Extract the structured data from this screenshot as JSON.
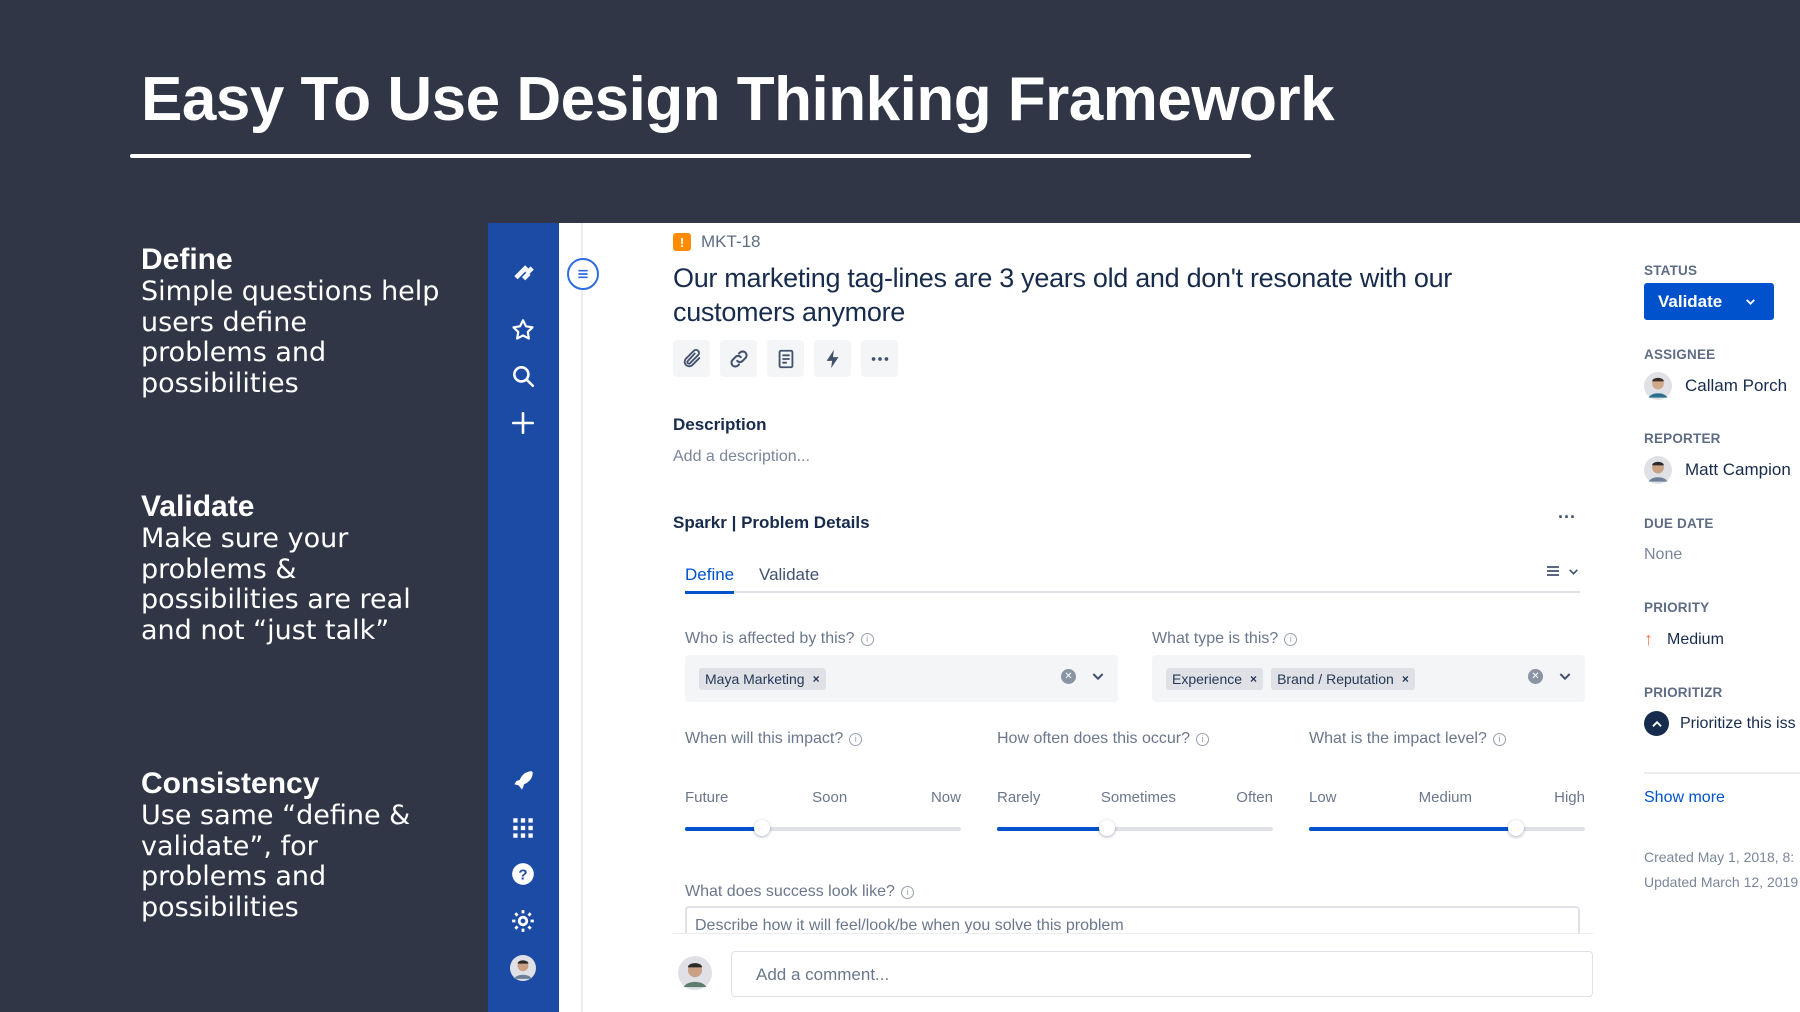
{
  "slide": {
    "title": "Easy To Use Design Thinking Framework",
    "features": [
      {
        "heading": "Define",
        "text": "Simple questions help users define problems and possibilities"
      },
      {
        "heading": "Validate",
        "text": "Make sure your problems & possibilities are real and not “just talk”"
      },
      {
        "heading": "Consistency",
        "text": "Use same “define & validate”, for problems and possibilities"
      }
    ]
  },
  "issue": {
    "key": "MKT-18",
    "type_icon": "!",
    "title": "Our marketing tag-lines are 3 years old and don't resonate with our customers anymore",
    "toolbar_icons": [
      "attachment-icon",
      "link-icon",
      "page-icon",
      "lightning-icon",
      "more-icon"
    ],
    "description_label": "Description",
    "description_placeholder": "Add a description..."
  },
  "panel": {
    "title": "Sparkr | Problem Details",
    "more": "···",
    "tabs": [
      "Define",
      "Validate"
    ],
    "active_tab": "Define",
    "q_affected": "Who is affected by this?",
    "affected_chips": [
      "Maya Marketing"
    ],
    "q_type": "What type is this?",
    "type_chips": [
      "Experience",
      "Brand / Reputation"
    ],
    "chip_remove": "×",
    "scales": [
      {
        "question": "When will this impact?",
        "labels": [
          "Future",
          "Soon",
          "Now"
        ],
        "value_pct": 28
      },
      {
        "question": "How often does this occur?",
        "labels": [
          "Rarely",
          "Sometimes",
          "Often"
        ],
        "value_pct": 40
      },
      {
        "question": "What is the impact level?",
        "labels": [
          "Low",
          "Medium",
          "High"
        ],
        "value_pct": 75
      }
    ],
    "q_success": "What does success look like?",
    "success_placeholder": "Describe how it will feel/look/be when you solve this problem"
  },
  "comment": {
    "placeholder": "Add a comment..."
  },
  "details": {
    "status_label": "STATUS",
    "status_value": "Validate",
    "assignee_label": "ASSIGNEE",
    "assignee": "Callam Porch",
    "reporter_label": "REPORTER",
    "reporter": "Matt Campion",
    "due_label": "DUE DATE",
    "due_value": "None",
    "priority_label": "PRIORITY",
    "priority_value": "Medium",
    "prioritizr_label": "PRIORITIZR",
    "prioritizr_value": "Prioritize this iss",
    "show_more": "Show more",
    "created": "Created May 1, 2018, 8:",
    "updated": "Updated March 12, 2019"
  },
  "colors": {
    "slide_bg": "#303645",
    "nav_blue": "#1c4ba5",
    "accent": "#0052cc"
  }
}
